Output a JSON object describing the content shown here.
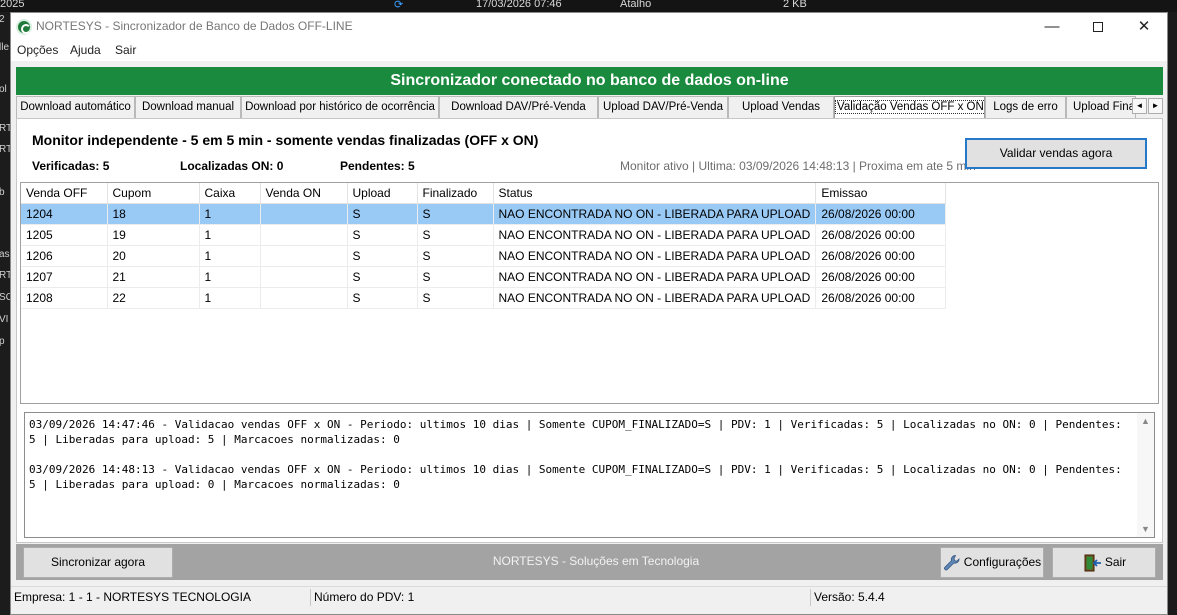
{
  "background": {
    "taskbar_items": [
      "2025",
      "17/03/2026 07:46",
      "Atalho",
      "2 KB"
    ],
    "side_fragments": [
      "2",
      "lle",
      "ol",
      "RT",
      "RT",
      "b",
      "as",
      "RT",
      "SC",
      "VI",
      "p"
    ]
  },
  "window": {
    "title": "NORTESYS - Sincronizador de Banco de Dados OFF-LINE",
    "min_glyph": "—",
    "close_glyph": "✕"
  },
  "menu": {
    "items": [
      "Opções",
      "Ajuda",
      "Sair"
    ]
  },
  "banner": "Sincronizador conectado no banco de dados on-line",
  "tabs": [
    "Download automático",
    "Download manual",
    "Download por histórico de ocorrência",
    "Download DAV/Pré-Venda",
    "Upload DAV/Pré-Venda",
    "Upload Vendas",
    "Validação Vendas OFF x ON",
    "Logs de erro",
    "Upload Fina"
  ],
  "tab_scroll": {
    "left": "◄",
    "right": "►"
  },
  "monitor": {
    "title": "Monitor independente - 5 em 5 min - somente vendas finalizadas (OFF x ON)",
    "verificadas": "Verificadas: 5",
    "localizadas": "Localizadas ON: 0",
    "pendentes": "Pendentes: 5",
    "status": "Monitor ativo | Ultima: 03/09/2026 14:48:13 | Proxima em ate 5 min",
    "validate_button": "Validar vendas agora"
  },
  "grid": {
    "columns": [
      "Venda OFF",
      "Cupom",
      "Caixa",
      "Venda ON",
      "Upload",
      "Finalizado",
      "Status",
      "Emissao"
    ],
    "rows": [
      [
        "1204",
        "18",
        "1",
        "",
        "S",
        "S",
        "NAO ENCONTRADA NO ON - LIBERADA PARA UPLOAD",
        "26/08/2026 00:00"
      ],
      [
        "1205",
        "19",
        "1",
        "",
        "S",
        "S",
        "NAO ENCONTRADA NO ON - LIBERADA PARA UPLOAD",
        "26/08/2026 00:00"
      ],
      [
        "1206",
        "20",
        "1",
        "",
        "S",
        "S",
        "NAO ENCONTRADA NO ON - LIBERADA PARA UPLOAD",
        "26/08/2026 00:00"
      ],
      [
        "1207",
        "21",
        "1",
        "",
        "S",
        "S",
        "NAO ENCONTRADA NO ON - LIBERADA PARA UPLOAD",
        "26/08/2026 00:00"
      ],
      [
        "1208",
        "22",
        "1",
        "",
        "S",
        "S",
        "NAO ENCONTRADA NO ON - LIBERADA PARA UPLOAD",
        "26/08/2026 00:00"
      ]
    ]
  },
  "log": {
    "entries": [
      "03/09/2026 14:47:46 - Validacao vendas OFF x ON - Periodo: ultimos 10 dias | Somente CUPOM_FINALIZADO=S | PDV: 1 | Verificadas: 5 | Localizadas no ON: 0 | Pendentes: 5 | Liberadas para upload: 5 | Marcacoes normalizadas: 0",
      "03/09/2026 14:48:13 - Validacao vendas OFF x ON - Periodo: ultimos 10 dias | Somente CUPOM_FINALIZADO=S | PDV: 1 | Verificadas: 5 | Localizadas no ON: 0 | Pendentes: 5 | Liberadas para upload: 0 | Marcacoes normalizadas: 0"
    ],
    "scroll_up": "▲",
    "scroll_down": "▼"
  },
  "bottom": {
    "sync_button": "Sincronizar agora",
    "center_text": "NORTESYS - Soluções em Tecnologia",
    "config_button": "Configurações",
    "exit_button": "Sair"
  },
  "statusbar": {
    "empresa": "Empresa: 1 - 1 - NORTESYS TECNOLOGIA",
    "pdv": "Número do PDV: 1",
    "versao": "Versão: 5.4.4"
  },
  "colors": {
    "banner": "#1a8a3e",
    "selected_row": "#99c9f5",
    "focus_border": "#2678c9"
  }
}
